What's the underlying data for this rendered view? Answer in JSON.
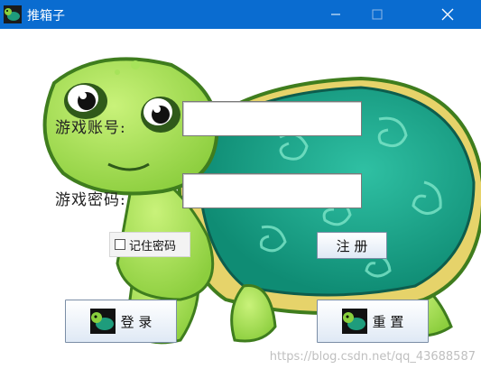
{
  "window": {
    "title": "推箱子",
    "minimize_icon": "minimize-icon",
    "maximize_icon": "maximize-icon",
    "close_icon": "close-icon"
  },
  "form": {
    "account_label": "游戏账号:",
    "account_value": "",
    "password_label": "游戏密码:",
    "password_value": "",
    "remember_label": "记住密码",
    "remember_checked": false,
    "register_label": "注 册",
    "login_label": "登 录",
    "reset_label": "重 置"
  },
  "watermark": "https://blog.csdn.net/qq_43688587",
  "colors": {
    "titlebar": "#0a6cd0",
    "turtle_green": "#9ad84a",
    "shell_teal": "#1aa38a",
    "shell_rim": "#e6d36a"
  }
}
